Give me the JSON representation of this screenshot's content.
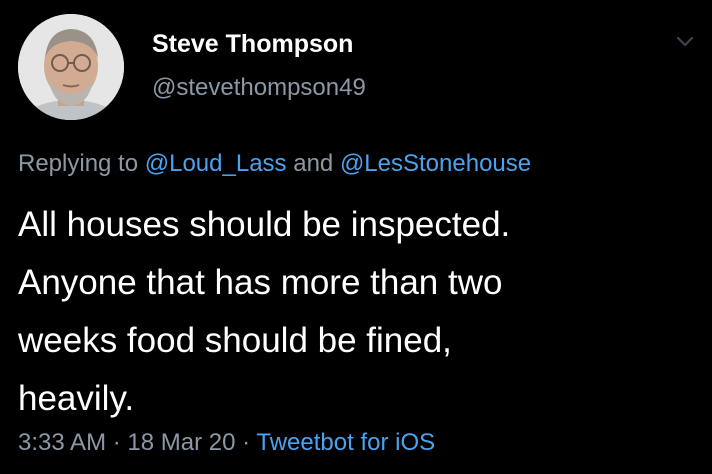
{
  "author": {
    "display_name": "Steve Thompson",
    "handle": "@stevethompson49",
    "avatar_icon": "profile-photo"
  },
  "menu": {
    "icon": "chevron-down-icon"
  },
  "reply": {
    "prefix": "Replying to",
    "mentions": [
      "@Loud_Lass",
      "@LesStonehouse"
    ],
    "joiner": "and"
  },
  "body": {
    "lines": [
      "All houses should be inspected.",
      "Anyone that has more than two",
      "weeks food should be fined,",
      "heavily."
    ]
  },
  "meta": {
    "time": "3:33 AM",
    "separator": "·",
    "date": "18 Mar 20",
    "source": "Tweetbot for iOS"
  },
  "colors": {
    "background": "#000000",
    "primary_text": "#ffffff",
    "secondary_text": "#8b98a5",
    "link": "#4aa3ef"
  }
}
